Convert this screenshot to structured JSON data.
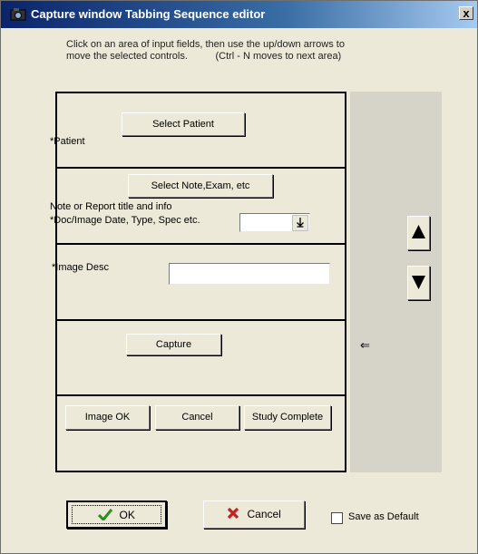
{
  "window": {
    "title": "Capture window Tabbing Sequence editor",
    "close_glyph": "x"
  },
  "instructions": {
    "line1": "Click on an area of input fields, then use the up/down arrows to",
    "line2": "move the selected controls.          (Ctrl - N moves to next area)"
  },
  "sections": {
    "patient": {
      "button_label": "Select Patient",
      "label": "*Patient"
    },
    "note": {
      "button_label": "Select Note,Exam, etc",
      "label_line1": "Note or Report title and info",
      "label_line2": "*Doc/Image Date, Type, Spec etc.",
      "dropdown_value": ""
    },
    "image_desc": {
      "label": "*Image Desc",
      "value": ""
    },
    "capture": {
      "button_label": "Capture"
    },
    "status": {
      "image_ok_label": "Image OK",
      "cancel_label": "Cancel",
      "study_complete_label": "Study Complete"
    }
  },
  "move_controls": {
    "up_icon": "triangle-up",
    "down_icon": "triangle-down",
    "pointer_glyph": "⇐"
  },
  "footer": {
    "ok_label": "OK",
    "cancel_label": "Cancel",
    "save_default_label": "Save as Default",
    "save_default_checked": false
  },
  "colors": {
    "titlebar_start": "#0a246a",
    "titlebar_end": "#a6caf0",
    "ok_check": "#2e8b1f",
    "cancel_x": "#c81e1e"
  }
}
